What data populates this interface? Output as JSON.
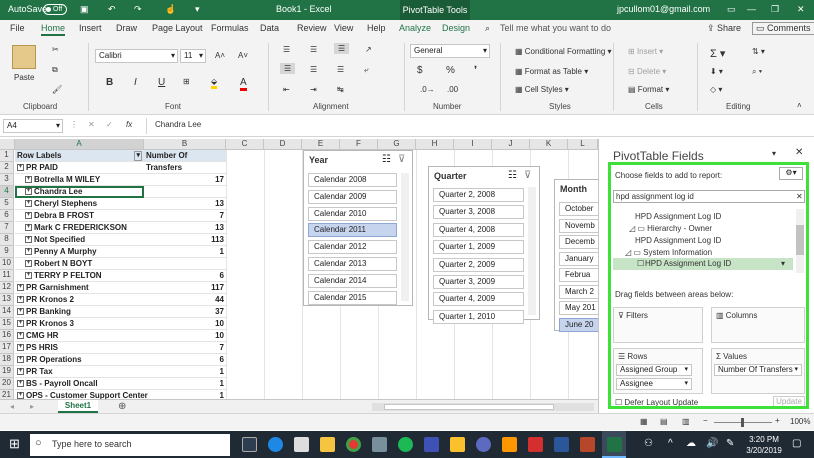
{
  "titlebar": {
    "autosave_label": "AutoSave",
    "autosave_state": "Off",
    "doc_title": "Book1 - Excel",
    "context_tab": "PivotTable Tools",
    "user_email": "jpcullom01@gmail.com",
    "accent_color": "#217346"
  },
  "tabs": [
    "File",
    "Home",
    "Insert",
    "Draw",
    "Page Layout",
    "Formulas",
    "Data",
    "Review",
    "View",
    "Help",
    "Analyze",
    "Design"
  ],
  "tell_me": "Tell me what you want to do",
  "share_label": "Share",
  "comments_label": "Comments",
  "ribbon": {
    "clipboard": {
      "label": "Clipboard",
      "paste": "Paste"
    },
    "font": {
      "label": "Font",
      "name": "Calibri",
      "size": "11",
      "bold": "B",
      "italic": "I",
      "underline": "U"
    },
    "alignment": {
      "label": "Alignment"
    },
    "number": {
      "label": "Number",
      "format": "General",
      "currency": "$",
      "percent": "%"
    },
    "styles": {
      "label": "Styles",
      "conditional": "Conditional Formatting",
      "format_table": "Format as Table",
      "cell_styles": "Cell Styles"
    },
    "cells": {
      "label": "Cells",
      "insert": "Insert",
      "delete": "Delete",
      "format": "Format"
    },
    "editing": {
      "label": "Editing"
    }
  },
  "formula_bar": {
    "name_box": "A4",
    "fx": "fx",
    "content": "Chandra Lee"
  },
  "grid": {
    "columns": [
      "A",
      "B",
      "C",
      "D",
      "E",
      "F",
      "G",
      "H",
      "I",
      "J",
      "K",
      "L"
    ],
    "rows": [
      {
        "n": "1",
        "a": "Row Labels",
        "b": "Number Of Transfers",
        "type": "header"
      },
      {
        "n": "2",
        "a": "PR PAID",
        "b": "",
        "type": "group"
      },
      {
        "n": "3",
        "a": "Botrella M WILEY",
        "b": "17",
        "type": "sub"
      },
      {
        "n": "4",
        "a": "Chandra Lee",
        "b": "",
        "type": "sub"
      },
      {
        "n": "5",
        "a": "Cheryl Stephens",
        "b": "13",
        "type": "sub"
      },
      {
        "n": "6",
        "a": "Debra B FROST",
        "b": "7",
        "type": "sub"
      },
      {
        "n": "7",
        "a": "Mark C FREDERICKSON",
        "b": "13",
        "type": "sub"
      },
      {
        "n": "8",
        "a": "Not Specified",
        "b": "113",
        "type": "sub"
      },
      {
        "n": "9",
        "a": "Penny A Murphy",
        "b": "1",
        "type": "sub"
      },
      {
        "n": "10",
        "a": "Robert N BOYT",
        "b": "",
        "type": "sub"
      },
      {
        "n": "11",
        "a": "TERRY P FELTON",
        "b": "6",
        "type": "sub"
      },
      {
        "n": "12",
        "a": "PR Garnishment",
        "b": "117",
        "type": "group"
      },
      {
        "n": "13",
        "a": "PR Kronos 2",
        "b": "44",
        "type": "group"
      },
      {
        "n": "14",
        "a": "PR Banking",
        "b": "37",
        "type": "group"
      },
      {
        "n": "15",
        "a": "PR Kronos 3",
        "b": "10",
        "type": "group"
      },
      {
        "n": "16",
        "a": "CMG HR",
        "b": "10",
        "type": "group"
      },
      {
        "n": "17",
        "a": "PS HRIS",
        "b": "7",
        "type": "group"
      },
      {
        "n": "18",
        "a": "PR Operations",
        "b": "6",
        "type": "group"
      },
      {
        "n": "19",
        "a": "PR Tax",
        "b": "1",
        "type": "group"
      },
      {
        "n": "20",
        "a": "BS - Payroll Oncall",
        "b": "1",
        "type": "group"
      },
      {
        "n": "21",
        "a": "OPS - Customer Support Center",
        "b": "1",
        "type": "group"
      }
    ]
  },
  "slicers": {
    "year": {
      "title": "Year",
      "items": [
        "Calendar 2008",
        "Calendar 2009",
        "Calendar 2010",
        "Calendar 2011",
        "Calendar 2012",
        "Calendar 2013",
        "Calendar 2014",
        "Calendar 2015"
      ],
      "selected": "Calendar 2011"
    },
    "quarter": {
      "title": "Quarter",
      "items": [
        "Quarter 2, 2008",
        "Quarter 3, 2008",
        "Quarter 4, 2008",
        "Quarter 1, 2009",
        "Quarter 2, 2009",
        "Quarter 3, 2009",
        "Quarter 4, 2009",
        "Quarter 1, 2010"
      ]
    },
    "month": {
      "title": "Month",
      "items": [
        "October",
        "Novemb",
        "Decemb",
        "January",
        "Februa",
        "March 2",
        "May 201",
        "June 20"
      ],
      "selected": "June 20"
    }
  },
  "sheet_tab": "Sheet1",
  "pivot_pane": {
    "title": "PivotTable Fields",
    "choose_label": "Choose fields to add to report:",
    "search_value": "hpd assignment log id",
    "fields": [
      "HPD Assignment Log ID",
      "Hierarchy - Owner",
      "HPD Assignment Log ID",
      "System Information",
      "HPD Assignment Log ID"
    ],
    "drag_label": "Drag fields between areas below:",
    "filters_label": "Filters",
    "columns_label": "Columns",
    "rows_label": "Rows",
    "values_label": "Values",
    "rows_items": [
      "Assigned Group",
      "Assignee"
    ],
    "values_items": [
      "Number Of Transfers"
    ],
    "defer_label": "Defer Layout Update",
    "update_label": "Update"
  },
  "status": {
    "zoom": "100%"
  },
  "taskbar": {
    "search_placeholder": "Type here to search",
    "time": "3:20 PM",
    "date": "3/20/2019"
  }
}
